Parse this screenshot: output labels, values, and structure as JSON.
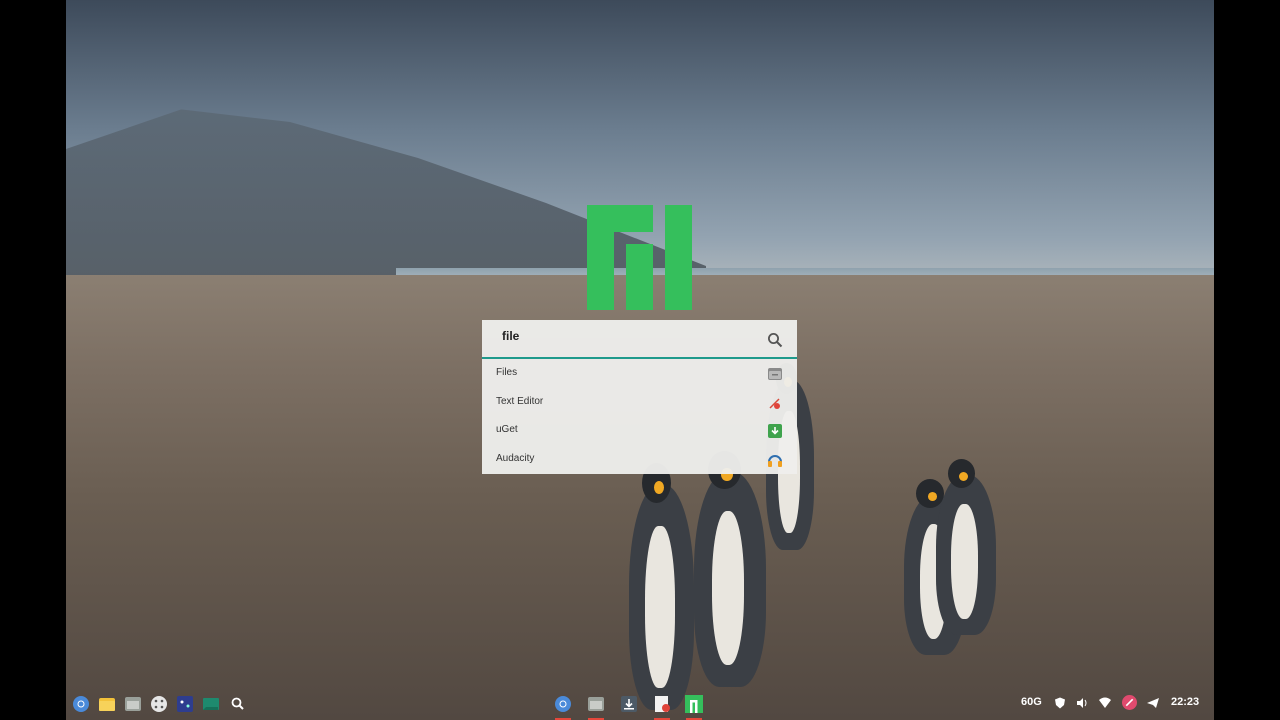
{
  "launcher": {
    "query": "file",
    "results": [
      {
        "label": "Files",
        "icon": "files-app-icon"
      },
      {
        "label": "Text Editor",
        "icon": "text-editor-icon"
      },
      {
        "label": "uGet",
        "icon": "uget-icon"
      },
      {
        "label": "Audacity",
        "icon": "audacity-icon"
      }
    ]
  },
  "logo": {
    "name": "manjaro-logo",
    "color": "#35bf5c"
  },
  "taskbar": {
    "left_icons": [
      "chrome-icon",
      "folder-icon",
      "files-icon",
      "app-grid-icon",
      "game-icon",
      "terminal-icon",
      "search-icon"
    ],
    "center_icons": [
      "chrome-icon",
      "files-icon",
      "download-icon",
      "text-editor-icon",
      "manjaro-icon"
    ],
    "storage": "60G",
    "clock": "22:23",
    "tray_icons": [
      "shield-icon",
      "volume-icon",
      "wifi-icon",
      "notification-icon",
      "telegram-icon"
    ]
  },
  "colors": {
    "accent": "#1f9a8c",
    "brand_green": "#35bf5c"
  }
}
